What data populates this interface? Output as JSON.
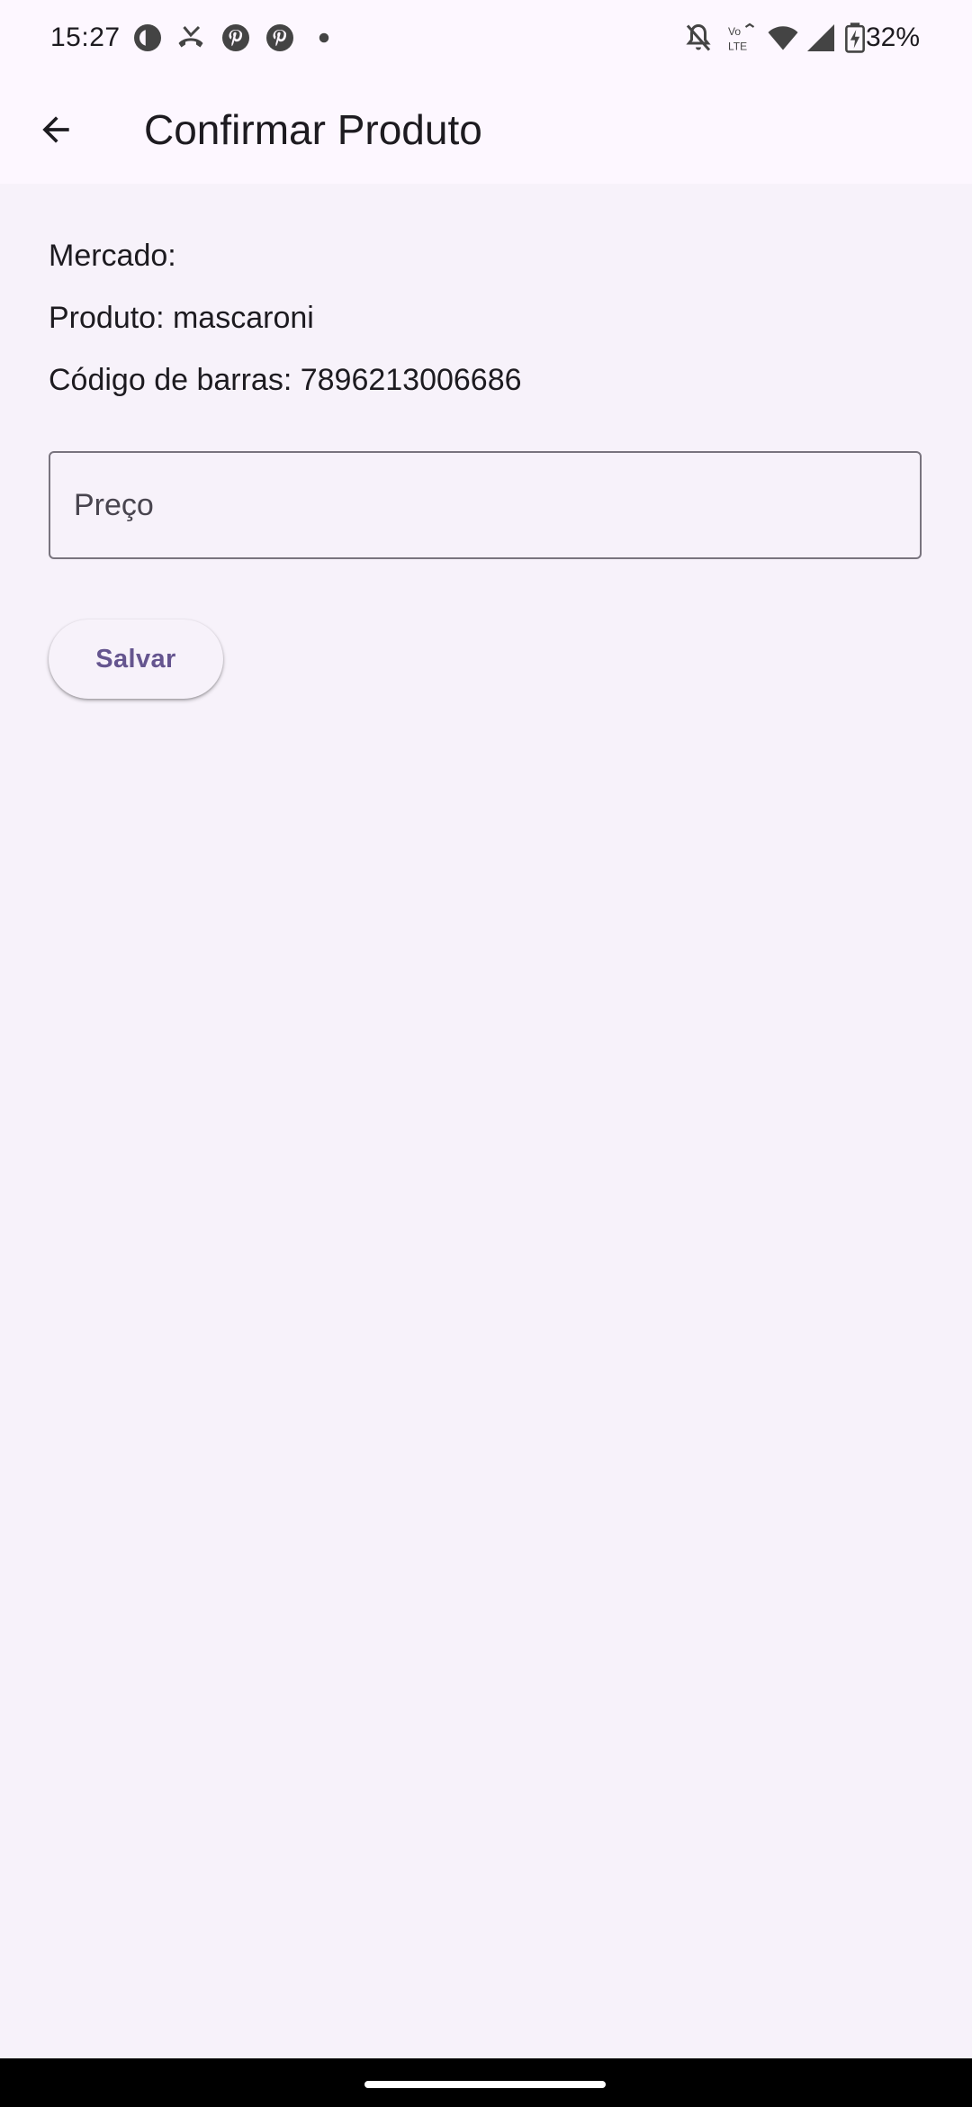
{
  "status_bar": {
    "time": "15:27",
    "battery_percent": "32%",
    "left_icons": [
      "threads-icon",
      "missed-call-icon",
      "pinterest-icon",
      "pinterest-icon",
      "dot-icon"
    ],
    "right_icons": [
      "bell-off-icon",
      "volte-icon",
      "wifi-icon",
      "signal-icon",
      "battery-charging-icon"
    ]
  },
  "app_bar": {
    "title": "Confirmar Produto",
    "back_icon": "arrow-back-icon"
  },
  "product": {
    "market_line": "Mercado:",
    "product_line": "Produto: mascaroni",
    "barcode_line": "Código de barras: 7896213006686"
  },
  "price_field": {
    "placeholder": "Preço",
    "value": ""
  },
  "actions": {
    "save_label": "Salvar"
  },
  "colors": {
    "background": "#f7f2fa",
    "app_bar": "#fdf7ff",
    "accent": "#65558f",
    "outline": "#79747e",
    "text": "#1d1b20"
  }
}
